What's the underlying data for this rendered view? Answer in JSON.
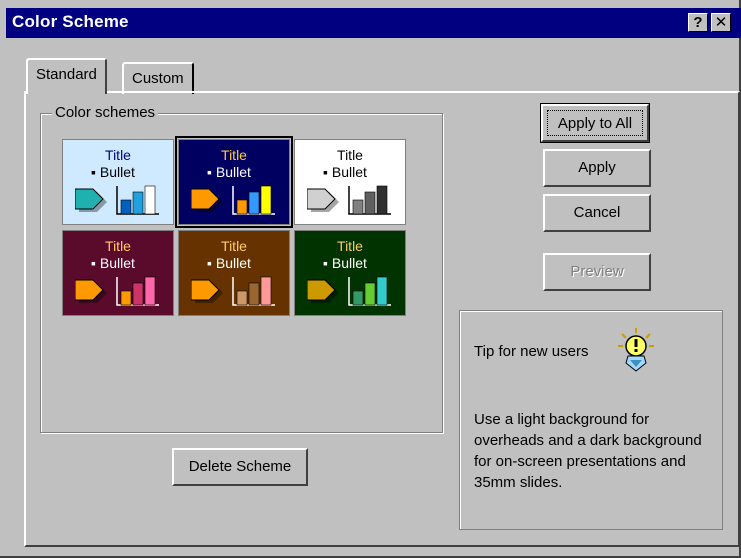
{
  "window": {
    "title": "Color Scheme",
    "help_glyph": "?",
    "close_glyph": "✕"
  },
  "tabs": [
    {
      "label": "Standard",
      "active": true
    },
    {
      "label": "Custom",
      "active": false
    }
  ],
  "color_schemes": {
    "group_label": "Color schemes",
    "items": [
      {
        "title": "Title",
        "bullet": "Bullet",
        "bg": "#cfeaff",
        "text": "#000080",
        "bullet_color": "#000000",
        "arrow": "#20b0b0",
        "bars": [
          "#0060c0",
          "#20a0e0",
          "#ffffff"
        ],
        "selected": false
      },
      {
        "title": "Title",
        "bullet": "Bullet",
        "bg": "#000060",
        "text": "#ffcc33",
        "bullet_color": "#ffffff",
        "arrow": "#ff9900",
        "bars": [
          "#ff9900",
          "#3399ff",
          "#ffff00"
        ],
        "selected": true
      },
      {
        "title": "Title",
        "bullet": "Bullet",
        "bg": "#ffffff",
        "text": "#000000",
        "bullet_color": "#000000",
        "arrow": "#d0d0d0",
        "bars": [
          "#808080",
          "#606060",
          "#303030"
        ],
        "selected": false
      },
      {
        "title": "Title",
        "bullet": "Bullet",
        "bg": "#5a0a2a",
        "text": "#ffcc66",
        "bullet_color": "#ffffff",
        "arrow": "#ff9900",
        "bars": [
          "#ff9900",
          "#cc3366",
          "#ff66aa"
        ],
        "selected": false
      },
      {
        "title": "Title",
        "bullet": "Bullet",
        "bg": "#663300",
        "text": "#ffcc66",
        "bullet_color": "#ffffff",
        "arrow": "#ff9900",
        "bars": [
          "#cc9966",
          "#996633",
          "#ff9999"
        ],
        "selected": false
      },
      {
        "title": "Title",
        "bullet": "Bullet",
        "bg": "#003300",
        "text": "#ffcc66",
        "bullet_color": "#ffffff",
        "arrow": "#cc9900",
        "bars": [
          "#339966",
          "#66cc33",
          "#33cccc"
        ],
        "selected": false
      }
    ]
  },
  "buttons": {
    "apply_to_all": "Apply to All",
    "apply": "Apply",
    "cancel": "Cancel",
    "preview": "Preview",
    "delete_scheme": "Delete Scheme"
  },
  "tip": {
    "heading": "Tip for new users",
    "body": "Use a light background for overheads and a dark background for on-screen presentations and 35mm slides.",
    "icon": "lightbulb-icon"
  }
}
